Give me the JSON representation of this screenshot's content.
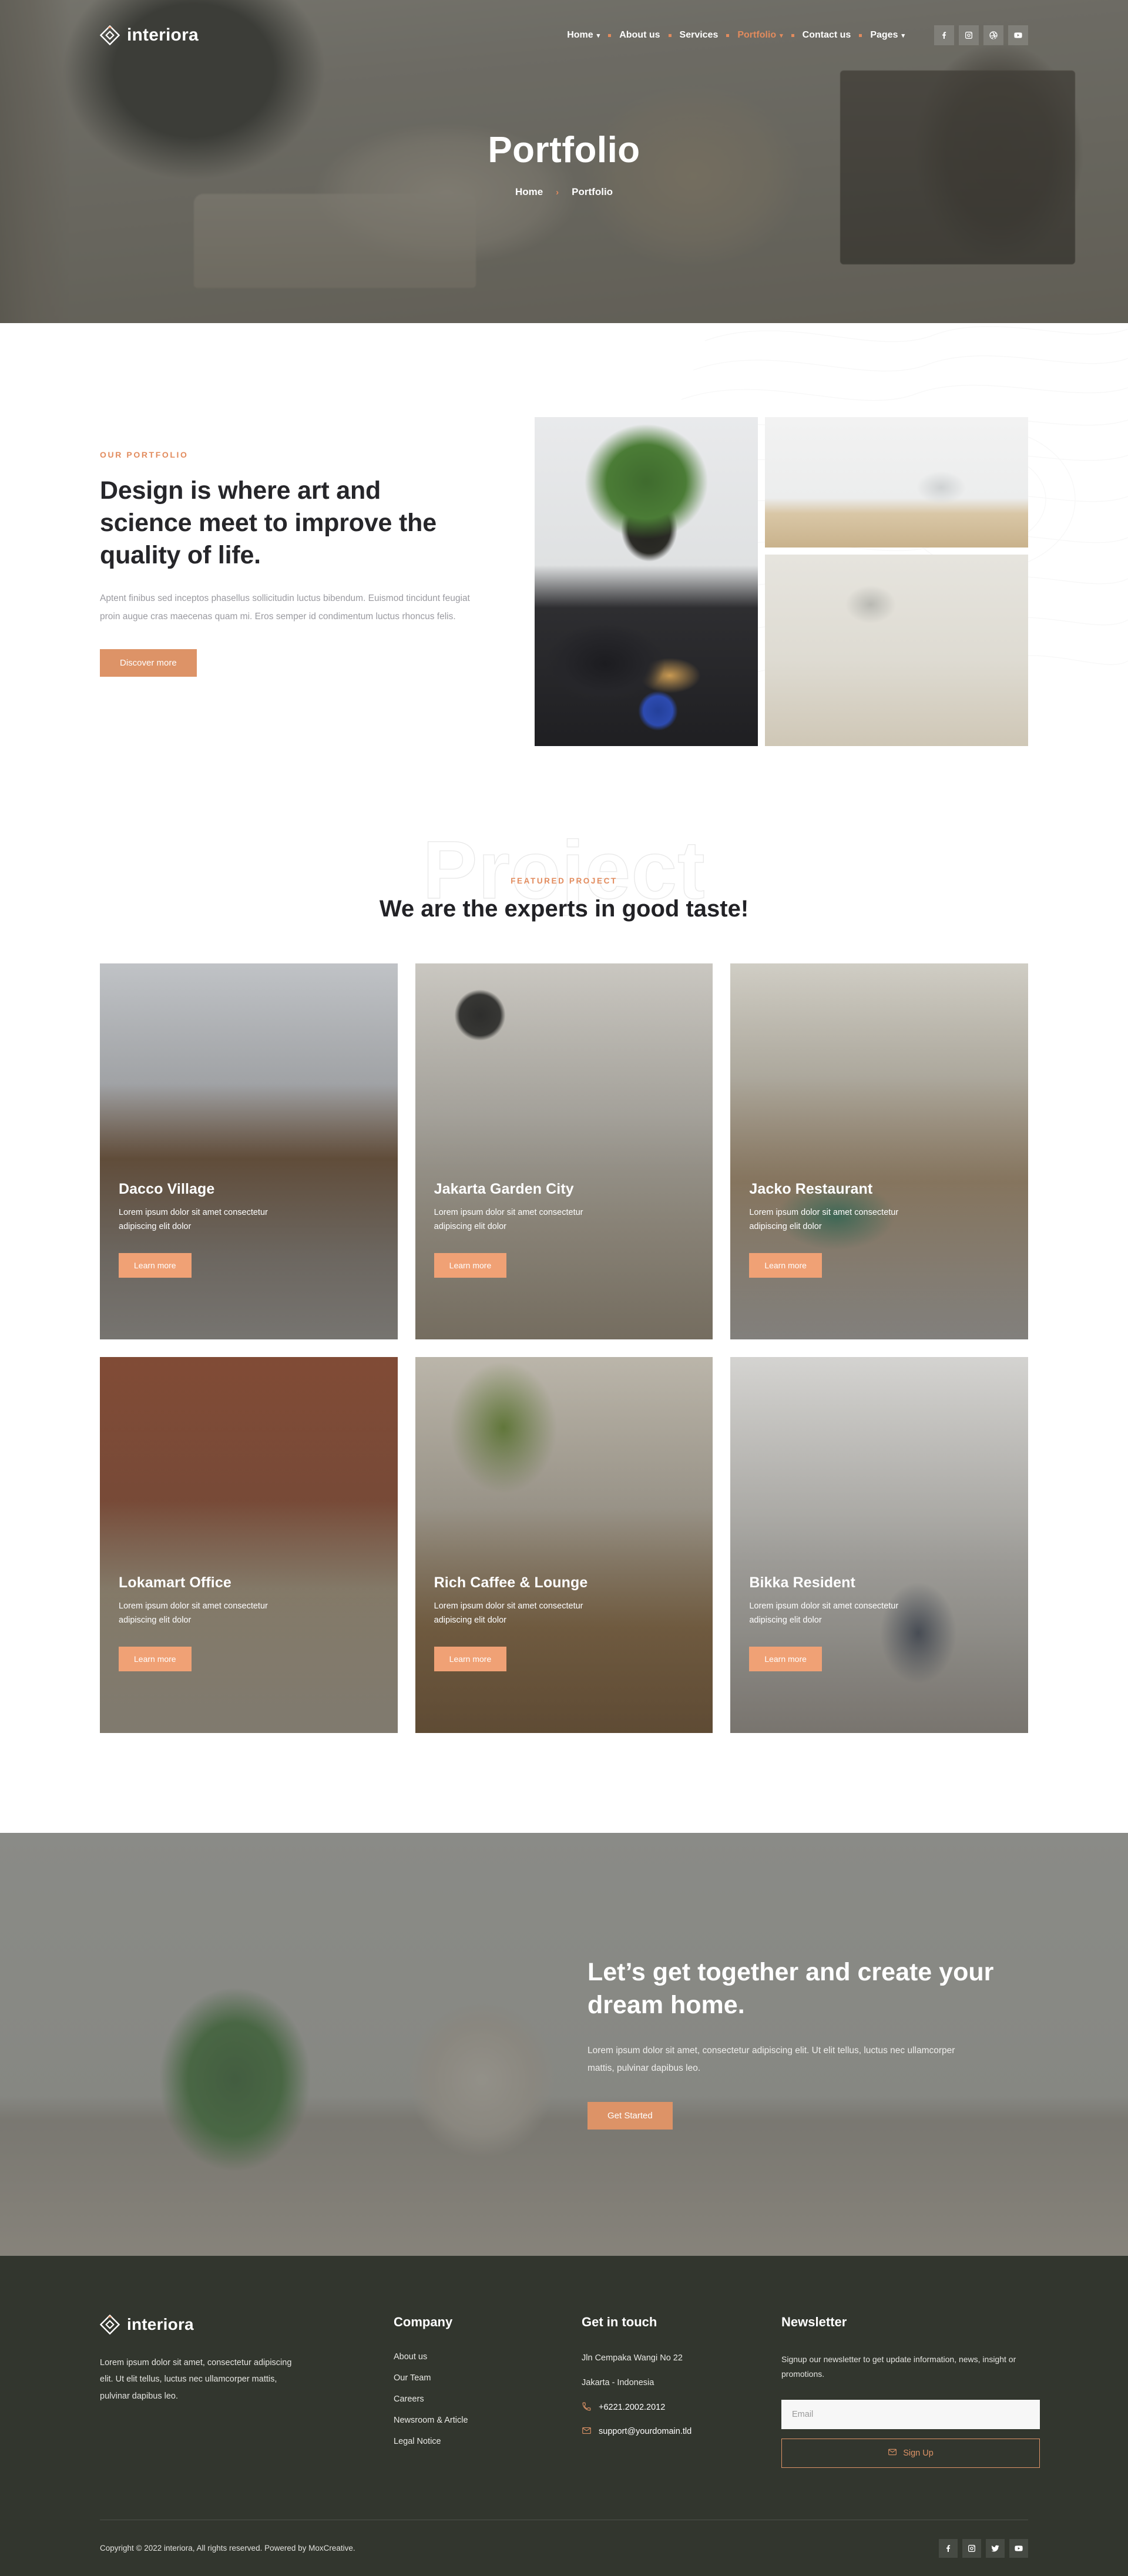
{
  "brand": {
    "name": "interiora",
    "logo_icon": "diamond-logo-icon"
  },
  "colors": {
    "accent": "#e28b5d",
    "button": "#dd9367",
    "card_button": "#f0a175",
    "footer_bg": "#32362e",
    "heading": "#26262a"
  },
  "nav": {
    "items": [
      {
        "label": "Home",
        "has_dropdown": true,
        "active": false
      },
      {
        "label": "About us",
        "has_dropdown": false,
        "active": false
      },
      {
        "label": "Services",
        "has_dropdown": false,
        "active": false
      },
      {
        "label": "Portfolio",
        "has_dropdown": true,
        "active": true
      },
      {
        "label": "Contact us",
        "has_dropdown": false,
        "active": false
      },
      {
        "label": "Pages",
        "has_dropdown": true,
        "active": false
      }
    ],
    "socials": [
      "facebook-icon",
      "instagram-icon",
      "dribbble-icon",
      "youtube-icon"
    ]
  },
  "hero": {
    "title": "Portfolio",
    "breadcrumb": {
      "home": "Home",
      "separator": "›",
      "current": "Portfolio"
    }
  },
  "intro": {
    "eyebrow": "OUR PORTFOLIO",
    "heading": "Design is where art and science meet to improve the quality of life.",
    "paragraph": "Aptent finibus sed inceptos phasellus sollicitudin luctus bibendum. Euismod tincidunt feugiat proin augue cras maecenas quam mi. Eros semper id condimentum luctus rhoncus felis.",
    "button": "Discover more",
    "gallery": [
      {
        "name": "kitchen-dining-photo"
      },
      {
        "name": "white-shelf-photo"
      },
      {
        "name": "moodboard-photo"
      }
    ]
  },
  "featured": {
    "watermark": "Project",
    "eyebrow": "FEATURED PROJECT",
    "heading": "We are the experts in good taste!",
    "cards": [
      {
        "title": "Dacco Village",
        "desc": "Lorem ipsum dolor sit amet consectetur adipiscing elit dolor",
        "button": "Learn more"
      },
      {
        "title": "Jakarta Garden City",
        "desc": "Lorem ipsum dolor sit amet consectetur adipiscing elit dolor",
        "button": "Learn more"
      },
      {
        "title": "Jacko Restaurant",
        "desc": "Lorem ipsum dolor sit amet consectetur adipiscing elit dolor",
        "button": "Learn more"
      },
      {
        "title": "Lokamart Office",
        "desc": "Lorem ipsum dolor sit amet consectetur adipiscing elit dolor",
        "button": "Learn more"
      },
      {
        "title": "Rich Caffee & Lounge",
        "desc": "Lorem ipsum dolor sit amet consectetur adipiscing elit dolor",
        "button": "Learn more"
      },
      {
        "title": "Bikka Resident",
        "desc": "Lorem ipsum dolor sit amet consectetur adipiscing elit dolor",
        "button": "Learn more"
      }
    ]
  },
  "cta": {
    "heading": "Let’s get together and create your dream home.",
    "paragraph": "Lorem ipsum dolor sit amet, consectetur adipiscing elit. Ut elit tellus, luctus nec ullamcorper mattis, pulvinar dapibus leo.",
    "button": "Get Started"
  },
  "footer": {
    "description": "Lorem ipsum dolor sit amet, consectetur adipiscing elit. Ut elit tellus, luctus nec ullamcorper mattis, pulvinar dapibus leo.",
    "company": {
      "title": "Company",
      "links": [
        "About us",
        "Our Team",
        "Careers",
        "Newsroom & Article",
        "Legal Notice"
      ]
    },
    "contact": {
      "title": "Get in touch",
      "address_line1": "Jln Cempaka Wangi No 22",
      "address_line2": "Jakarta - Indonesia",
      "phone": "+6221.2002.2012",
      "email": "support@yourdomain.tld"
    },
    "newsletter": {
      "title": "Newsletter",
      "description": "Signup our newsletter to get update information, news, insight or promotions.",
      "placeholder": "Email",
      "value": "",
      "button": "Sign Up"
    },
    "copyright": "Copyright © 2022 interiora, All rights reserved. Powered by MoxCreative.",
    "socials": [
      "facebook-icon",
      "instagram-icon",
      "twitter-icon",
      "youtube-icon"
    ]
  }
}
